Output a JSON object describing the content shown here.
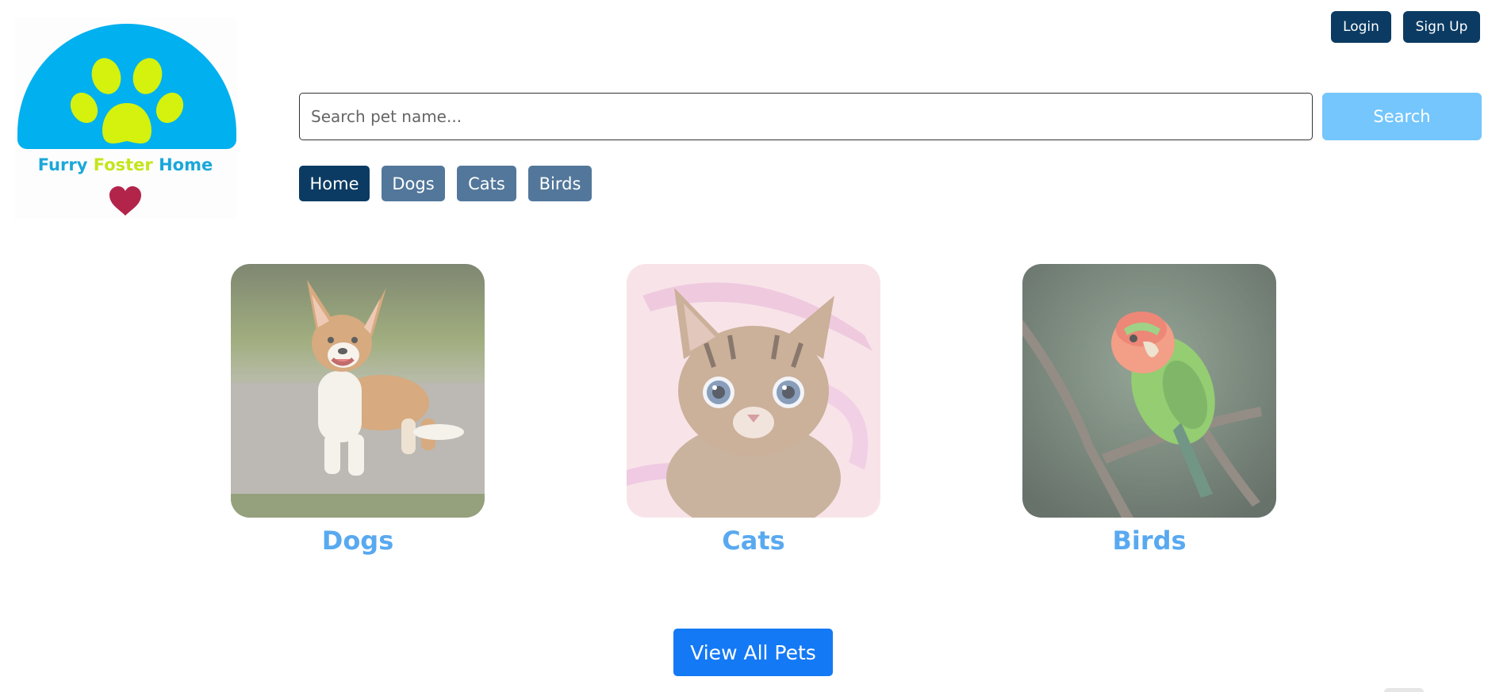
{
  "logo": {
    "word1": "Furry",
    "word2": "Foster",
    "word3": "Home",
    "icon": "paw-icon",
    "heart_icon": "heart-icon",
    "colors": {
      "dome": "#00b0ef",
      "paw": "#d4f20d",
      "heart": "#b3244a"
    }
  },
  "auth": {
    "login_label": "Login",
    "signup_label": "Sign Up"
  },
  "search": {
    "placeholder": "Search pet name...",
    "value": "",
    "button_label": "Search"
  },
  "nav": {
    "tabs": [
      {
        "label": "Home",
        "active": true
      },
      {
        "label": "Dogs",
        "active": false
      },
      {
        "label": "Cats",
        "active": false
      },
      {
        "label": "Birds",
        "active": false
      }
    ]
  },
  "categories": [
    {
      "label": "Dogs",
      "image": "corgi-photo"
    },
    {
      "label": "Cats",
      "image": "kitten-photo"
    },
    {
      "label": "Birds",
      "image": "lovebird-photo"
    }
  ],
  "view_all_label": "View All Pets",
  "colors": {
    "primary": "#0b3b63",
    "secondary": "#52779a",
    "accent": "#1479f5",
    "link": "#59a9f0",
    "search_button": "#74c6fc"
  }
}
